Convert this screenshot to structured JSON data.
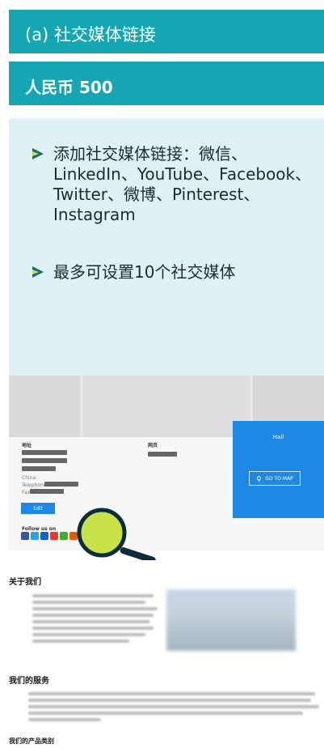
{
  "section_title": "(a) 社交媒体链接",
  "price": "人民币 500",
  "bullets": [
    "添加社交媒体链接：微信、LinkedIn、YouTube、Facebook、Twitter、微博、Pinterest、 Instagram",
    "最多可设置10个社交媒体"
  ],
  "preview": {
    "address_label": "地址",
    "phone_label": "网页",
    "country": "China",
    "telephone_label": "Telephone",
    "fax_label": "Fax",
    "edit_button": "Edit",
    "follow_label": "Follow us on",
    "hall_label": "Hall",
    "map_button": "GO TO MAP",
    "about_title": "关于我们",
    "services_title": "我们的服务",
    "categories_title": "我们的产品类别"
  },
  "colors": {
    "teal": "#14a6b2",
    "card_bg": "#dff1f5",
    "blue": "#1e88e5",
    "magnifier_rim": "#0b2d3b",
    "magnifier_lens": "#c9e24a"
  },
  "icons": [
    "arrow-bullet-icon",
    "map-pin-icon",
    "magnifier-icon",
    "facebook-icon",
    "linkedin-icon",
    "youtube-icon",
    "wechat-icon"
  ]
}
